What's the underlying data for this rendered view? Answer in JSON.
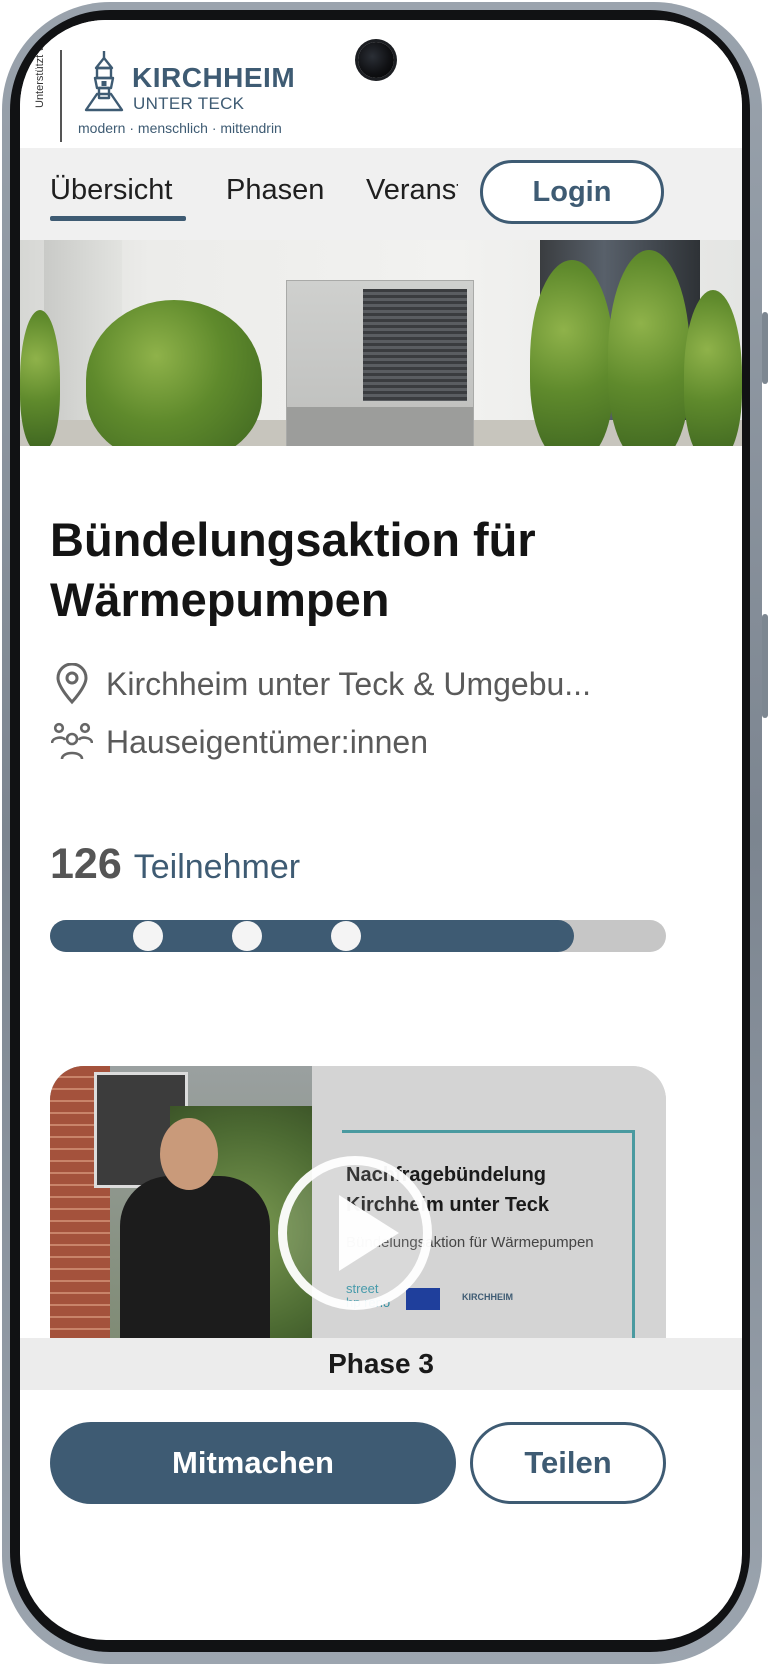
{
  "brand": {
    "supported_by": "Unterstützt von",
    "name": "KIRCHHEIM",
    "subname": "UNTER TECK",
    "tagline": "modern · menschlich · mittendrin"
  },
  "tabs": [
    {
      "label": "Übersicht",
      "active": true
    },
    {
      "label": "Phasen",
      "active": false
    },
    {
      "label": "Veranstaltungen",
      "active": false
    }
  ],
  "login_label": "Login",
  "campaign": {
    "title": "Bündelungsaktion für Wärmepumpen",
    "location": "Kirchheim unter Teck & Umgebu...",
    "audience": "Hauseigentümer:innen",
    "participants_count": "126",
    "participants_label": "Teilnehmer",
    "progress_fraction": 0.85,
    "phase_markers": 3
  },
  "video": {
    "slide_title_line1": "Nachfragebündelung",
    "slide_title_line2": "Kirchheim unter Teck",
    "slide_subtitle": "Bündelungsaktion für Wärmepumpen",
    "slide_logo_line1": "street",
    "slide_logo_line2": "hp reno",
    "slide_logo_kirchheim": "KIRCHHEIM",
    "phase_label": "Phase 3"
  },
  "actions": {
    "primary_label": "Mitmachen",
    "secondary_label": "Teilen"
  },
  "colors": {
    "accent": "#3e5b73",
    "track": "#c6c6c6",
    "tabbar_bg": "#f0f0f0"
  },
  "icons": {
    "location": "map-pin-icon",
    "audience": "people-group-icon",
    "play": "play-icon",
    "brand": "church-tower-icon"
  }
}
